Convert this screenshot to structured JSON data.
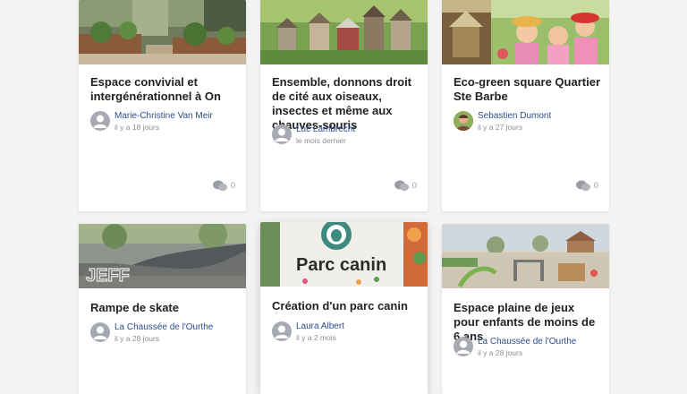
{
  "colors": {
    "author_link": "#2b4e8c",
    "muted": "#8a8d95",
    "background": "#f3f3f4"
  },
  "cards": [
    {
      "title": "Espace convivial et intergénérationnel à On",
      "author": "Marie-Christine Van Meir",
      "date": "il y a 18 jours",
      "comments": "0",
      "avatar": "default-avatar-icon"
    },
    {
      "title": "Ensemble, donnons droit de cité aux oiseaux, insectes et même aux chauves-souris",
      "author": "Luc Lambrecht",
      "date": "le mois dernier",
      "comments": "0",
      "avatar": "default-avatar-icon"
    },
    {
      "title": "Eco-green square Quartier Ste Barbe",
      "author": "Sebastien Dumont",
      "date": "il y a 27 jours",
      "comments": "0",
      "avatar": "photo-avatar"
    },
    {
      "title": "Rampe de skate",
      "author": "La Chaussée de l'Ourthe",
      "date": "il y a 28 jours",
      "avatar": "default-avatar-icon",
      "image_text": "JEFF"
    },
    {
      "title": "Création d'un parc canin",
      "author": "Laura Albert",
      "date": "il y a 2 mois",
      "avatar": "default-avatar-icon",
      "image_text": "Parc canin"
    },
    {
      "title": "Espace plaine de jeux pour enfants de moins de 6 ans",
      "author": "La Chaussée de l'Ourthe",
      "date": "il y a 28 jours",
      "avatar": "default-avatar-icon"
    }
  ]
}
